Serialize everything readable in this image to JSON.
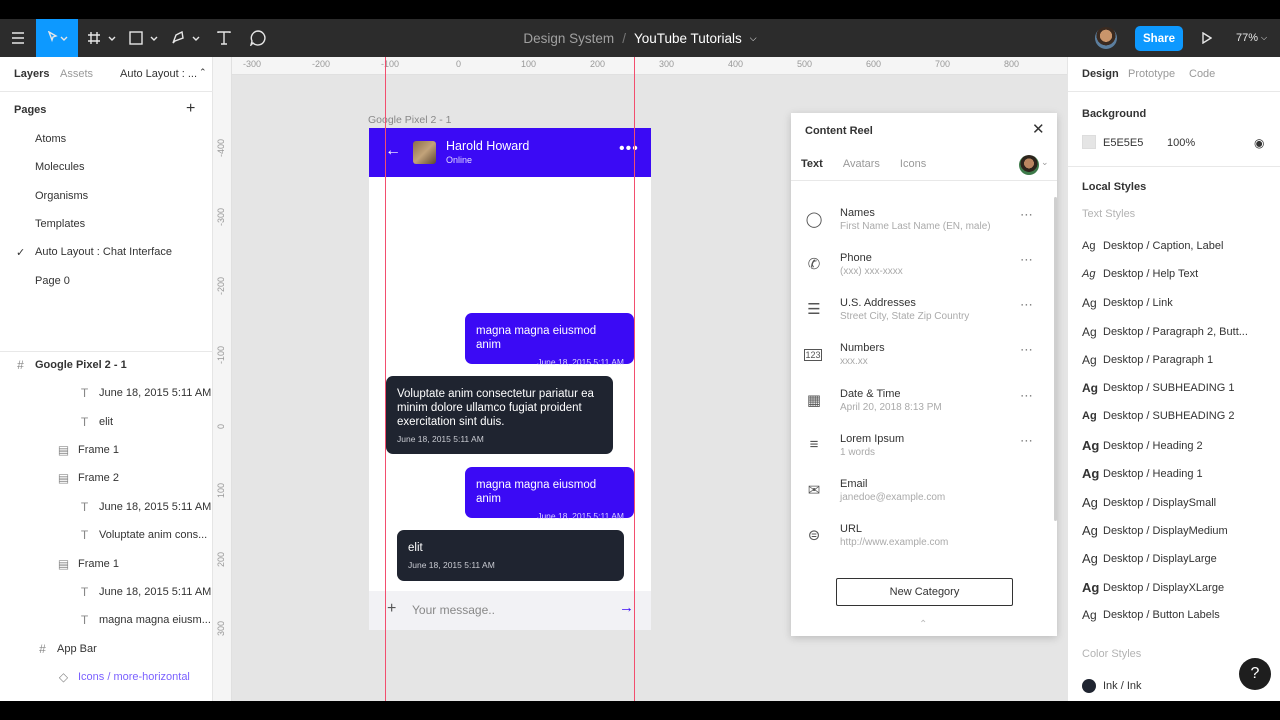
{
  "toolbar": {
    "breadcrumb_project": "Design System",
    "breadcrumb_separator": "/",
    "breadcrumb_file": "YouTube Tutorials",
    "share_label": "Share",
    "zoom": "77%"
  },
  "left_panel": {
    "tabs": [
      "Layers",
      "Assets",
      "Auto Layout : ..."
    ],
    "pages_title": "Pages",
    "pages": [
      "Atoms",
      "Molecules",
      "Organisms",
      "Templates",
      "Auto Layout : Chat Interface",
      "Page 0"
    ],
    "layers": [
      {
        "label": "Google Pixel 2 - 1",
        "type": "frame"
      },
      {
        "label": "June 18, 2015 5:11 AM",
        "type": "text"
      },
      {
        "label": "elit",
        "type": "text"
      },
      {
        "label": "Frame 1",
        "type": "autolayout"
      },
      {
        "label": "Frame 2",
        "type": "autolayout"
      },
      {
        "label": "June 18, 2015 5:11 AM",
        "type": "text"
      },
      {
        "label": "Voluptate anim cons...",
        "type": "text"
      },
      {
        "label": "Frame 1",
        "type": "autolayout"
      },
      {
        "label": "June 18, 2015 5:11 AM",
        "type": "text"
      },
      {
        "label": "magna magna eiusm...",
        "type": "text"
      },
      {
        "label": "App Bar",
        "type": "frame"
      },
      {
        "label": "Icons / more-horizontal",
        "type": "component"
      }
    ]
  },
  "canvas": {
    "ruler_top": [
      "-300",
      "-200",
      "-100",
      "0",
      "100",
      "200",
      "300",
      "400",
      "500",
      "600",
      "700",
      "800"
    ],
    "ruler_left": [
      "-400",
      "-300",
      "-200",
      "-100",
      "0",
      "100",
      "200",
      "300"
    ],
    "frame_label": "Google Pixel 2 - 1",
    "chat": {
      "contact_name": "Harold Howard",
      "contact_status": "Online",
      "messages": [
        {
          "dir": "out",
          "text": "magna magna eiusmod anim",
          "date": "June 18, 2015 5:11 AM"
        },
        {
          "dir": "in",
          "text": "Voluptate anim consectetur pariatur ea minim dolore ullamco fugiat proident exercitation sint duis.",
          "date": "June 18, 2015 5:11 AM"
        },
        {
          "dir": "out",
          "text": "magna magna eiusmod anim",
          "date": "June 18, 2015 5:11 AM"
        },
        {
          "dir": "in",
          "text": "elit",
          "date": "June 18, 2015 5:11 AM"
        }
      ],
      "composer_placeholder": "Your message.."
    }
  },
  "content_reel": {
    "title": "Content Reel",
    "tabs": [
      "Text",
      "Avatars",
      "Icons"
    ],
    "categories": [
      {
        "name": "Names",
        "sample": "First Name Last Name (EN, male)",
        "icon": "person-icon"
      },
      {
        "name": "Phone",
        "sample": "(xxx) xxx-xxxx",
        "icon": "phone-icon"
      },
      {
        "name": "U.S. Addresses",
        "sample": "Street City, State Zip Country",
        "icon": "address-card-icon"
      },
      {
        "name": "Numbers",
        "sample": "xxx.xx",
        "icon": "numbers-icon"
      },
      {
        "name": "Date & Time",
        "sample": "April 20, 2018 8:13 PM",
        "icon": "calendar-icon"
      },
      {
        "name": "Lorem Ipsum",
        "sample": "1 words",
        "icon": "text-lines-icon"
      },
      {
        "name": "Email",
        "sample": "janedoe@example.com",
        "icon": "mail-icon"
      },
      {
        "name": "URL",
        "sample": "http://www.example.com",
        "icon": "link-icon"
      }
    ],
    "new_category_label": "New Category"
  },
  "right_panel": {
    "tabs": [
      "Design",
      "Prototype",
      "Code"
    ],
    "background_title": "Background",
    "background_hex": "E5E5E5",
    "background_opacity": "100%",
    "local_styles_title": "Local Styles",
    "text_styles_title": "Text Styles",
    "text_styles": [
      "Desktop / Caption, Label",
      "Desktop / Help Text",
      "Desktop / Link",
      "Desktop / Paragraph 2, Butt...",
      "Desktop / Paragraph 1",
      "Desktop / SUBHEADING 1",
      "Desktop / SUBHEADING 2",
      "Desktop / Heading 2",
      "Desktop / Heading 1",
      "Desktop / DisplaySmall",
      "Desktop / DisplayMedium",
      "Desktop / DisplayLarge",
      "Desktop / DisplayXLarge",
      "Desktop / Button Labels"
    ],
    "ag_label": "Ag",
    "color_styles_title": "Color Styles",
    "color_styles": [
      {
        "name": "Ink / Ink",
        "color": "#1f2430"
      }
    ],
    "help_label": "?"
  },
  "colors": {
    "accent": "#0d99ff",
    "chat_primary": "#3b0af5",
    "chat_dark": "#1f2430",
    "guide": "#f24e6e"
  }
}
